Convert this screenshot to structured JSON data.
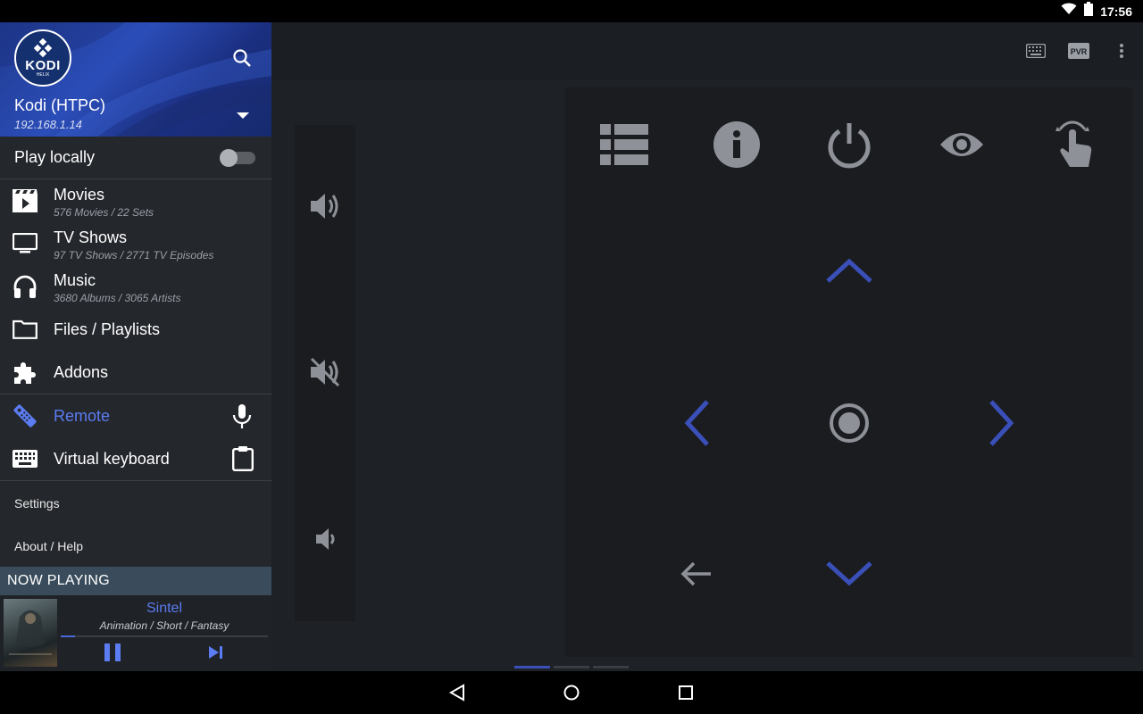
{
  "status_bar": {
    "time": "17:56"
  },
  "drawer": {
    "app_logo_text": "KODI",
    "app_logo_subtext": "HELIX",
    "host_name": "Kodi (HTPC)",
    "host_ip": "192.168.1.14",
    "play_locally_label": "Play locally",
    "play_locally_enabled": false,
    "items": [
      {
        "label": "Movies",
        "sub": "576 Movies / 22 Sets",
        "icon": "movie-clapper-icon"
      },
      {
        "label": "TV Shows",
        "sub": "97 TV Shows / 2771 TV Episodes",
        "icon": "tv-icon"
      },
      {
        "label": "Music",
        "sub": "3680 Albums / 3065 Artists",
        "icon": "headphones-icon"
      },
      {
        "label": "Files / Playlists",
        "icon": "folder-icon"
      },
      {
        "label": "Addons",
        "icon": "puzzle-icon"
      },
      {
        "label": "Remote",
        "icon": "remote-icon",
        "active": true,
        "action_icon": "microphone-icon"
      },
      {
        "label": "Virtual keyboard",
        "icon": "keyboard-icon",
        "action_icon": "clipboard-icon"
      }
    ],
    "settings_label": "Settings",
    "about_label": "About / Help"
  },
  "now_playing": {
    "header": "NOW PLAYING",
    "title": "Sintel",
    "genre": "Animation / Short / Fantasy",
    "poster_icon": "movie-poster-image",
    "progress": 0.07
  },
  "toolbar": {
    "icons": [
      "keyboard-icon",
      "pvr-icon",
      "overflow-menu-icon"
    ],
    "pvr_label": "PVR"
  },
  "volume": {
    "buttons": [
      "volume-up-icon",
      "mute-icon",
      "volume-down-icon"
    ]
  },
  "remote": {
    "top_buttons": [
      "list-icon",
      "info-icon",
      "power-icon",
      "eye-icon",
      "touch-gesture-icon"
    ],
    "dpad": [
      "up-arrow-icon",
      "left-arrow-icon",
      "select-icon",
      "right-arrow-icon",
      "down-arrow-icon",
      "back-arrow-icon"
    ]
  },
  "page_indicator": {
    "count": 3,
    "active_index": 0
  },
  "colors": {
    "accent": "#5b7cf2",
    "dpad_blue": "#3a4fb8",
    "drawer_bg": "#24272c",
    "header_blue": "#2b4db8"
  }
}
